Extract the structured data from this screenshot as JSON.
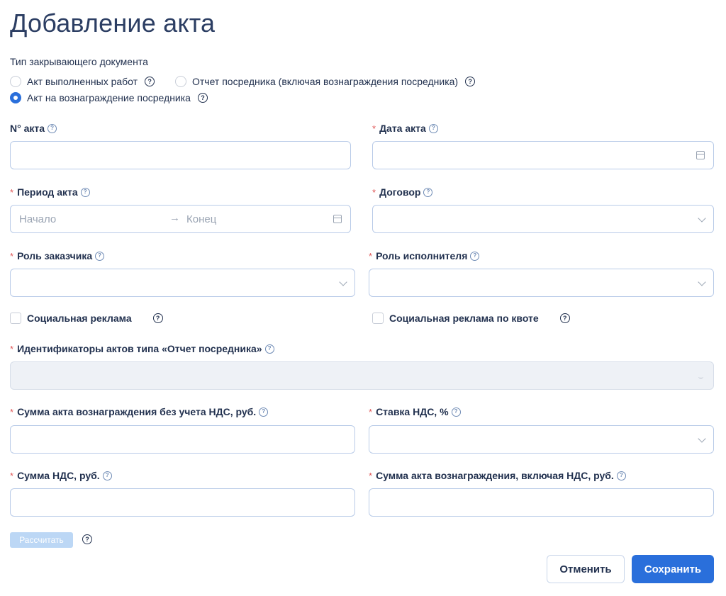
{
  "page": {
    "title": "Добавление акта"
  },
  "doc_type": {
    "label": "Тип закрывающего документа",
    "options": [
      {
        "label": "Акт выполненных работ",
        "checked": false
      },
      {
        "label": "Отчет посредника (включая вознаграждения посредника)",
        "checked": false
      },
      {
        "label": "Акт на вознаграждение посредника",
        "checked": true
      }
    ]
  },
  "fields": {
    "act_number": {
      "label": "N° акта",
      "value": ""
    },
    "act_date": {
      "label": "Дата акта",
      "value": ""
    },
    "act_period": {
      "label": "Период акта",
      "start_placeholder": "Начало",
      "end_placeholder": "Конец",
      "arrow": "→"
    },
    "contract": {
      "label": "Договор",
      "value": ""
    },
    "customer_role": {
      "label": "Роль заказчика",
      "value": ""
    },
    "executor_role": {
      "label": "Роль исполнителя",
      "value": ""
    },
    "intermediary_ids": {
      "label": "Идентификаторы актов типа «Отчет посредника»",
      "value": ""
    },
    "sum_without_vat": {
      "label": "Сумма акта вознаграждения без учета НДС, руб.",
      "value": ""
    },
    "vat_rate": {
      "label": "Ставка НДС, %",
      "value": ""
    },
    "vat_sum": {
      "label": "Сумма НДС, руб.",
      "value": ""
    },
    "sum_with_vat": {
      "label": "Сумма акта вознаграждения, включая НДС, руб.",
      "value": ""
    }
  },
  "checkboxes": {
    "social_ad": {
      "label": "Социальная реклама",
      "checked": false
    },
    "social_ad_quota": {
      "label": "Социальная реклама по квоте",
      "checked": false
    }
  },
  "actions": {
    "calculate": "Рассчитать",
    "cancel": "Отменить",
    "save": "Сохранить"
  },
  "icons": {
    "help": "help-icon",
    "calendar": "calendar-icon",
    "dropdown": "chevron-down-icon",
    "arrow": "arrow-right-icon"
  },
  "colors": {
    "accent": "#2a6fdb",
    "required": "#e05a5a",
    "text": "#22314f",
    "field_border": "#b9cbe8",
    "disabled_bg": "#eef1f6",
    "calc_button": "#bcd7f5"
  }
}
